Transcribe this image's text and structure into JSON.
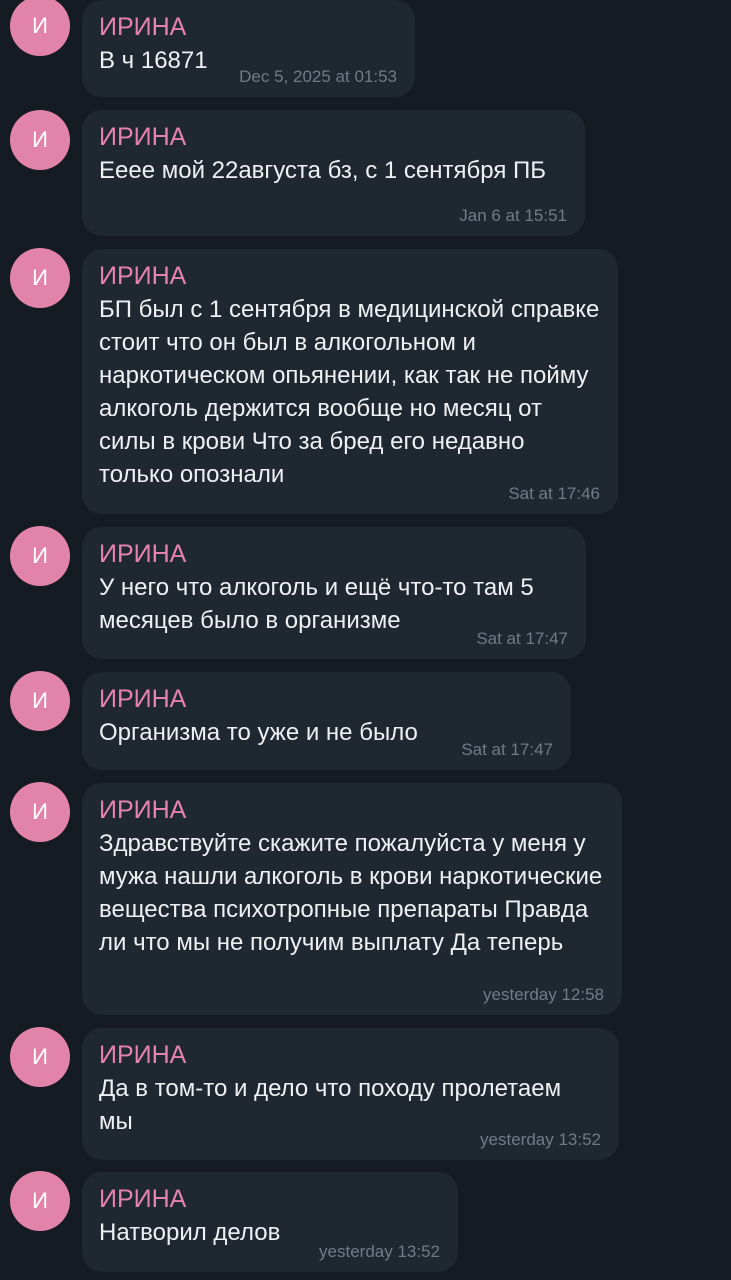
{
  "messages": [
    {
      "avatar_letter": "И",
      "sender": "ИРИНА",
      "text": "В ч 16871",
      "time": "Dec 5, 2025 at 01:53"
    },
    {
      "avatar_letter": "И",
      "sender": "ИРИНА",
      "text": "Ееее мой 22августа бз, с 1 сентября ПБ",
      "time": "Jan 6 at 15:51"
    },
    {
      "avatar_letter": "И",
      "sender": "ИРИНА",
      "text": "БП был с 1 сентября в медицинской справке стоит что он был в алкогольном и наркотическом опьянении, как так не пойму алкоголь держится вообще но месяц от силы в крови Что за бред его недавно только опознали",
      "time": "Sat at 17:46"
    },
    {
      "avatar_letter": "И",
      "sender": "ИРИНА",
      "text": "У него что алкоголь и ещё что-то там 5 месяцев было в организме",
      "time": "Sat at 17:47"
    },
    {
      "avatar_letter": "И",
      "sender": "ИРИНА",
      "text": "Организма то уже и не было",
      "time": "Sat at 17:47"
    },
    {
      "avatar_letter": "И",
      "sender": "ИРИНА",
      "text": "Здравствуйте скажите пожалуйста у меня у мужа нашли алкоголь в крови наркотические вещества психотропные препараты Правда ли что мы не получим выплату Да теперь",
      "time": "yesterday 12:58"
    },
    {
      "avatar_letter": "И",
      "sender": "ИРИНА",
      "text": "Да в том-то и дело что походу пролетаем мы",
      "time": "yesterday 13:52"
    },
    {
      "avatar_letter": "И",
      "sender": "ИРИНА",
      "text": "Натворил делов",
      "time": "yesterday 13:52"
    }
  ],
  "colors": {
    "background": "#151b22",
    "bubble": "#1f2730",
    "avatar": "#e284aa",
    "sender": "#e582ae",
    "text": "#eef1f4",
    "time": "#6f7c88"
  }
}
